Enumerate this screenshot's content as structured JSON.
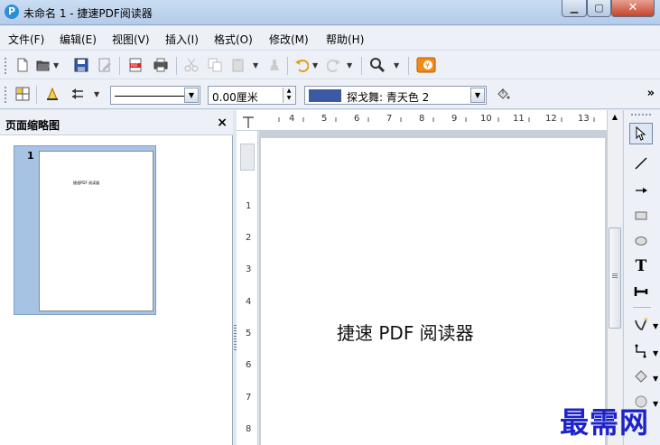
{
  "window": {
    "title": "未命名 1 - 捷速PDF阅读器",
    "app_icon_glyph": "P",
    "min_glyph": "▁",
    "max_glyph": "▢",
    "close_glyph": "✕"
  },
  "menu": [
    {
      "label": "文件(F)"
    },
    {
      "label": "编辑(E)"
    },
    {
      "label": "视图(V)"
    },
    {
      "label": "插入(I)"
    },
    {
      "label": "格式(O)"
    },
    {
      "label": "修改(M)"
    },
    {
      "label": "帮助(H)"
    }
  ],
  "toolbar1": {
    "icons": [
      "new-icon",
      "open-icon",
      "save-icon",
      "edit-icon",
      "export-pdf-icon",
      "print-icon",
      "cut-icon",
      "copy-icon",
      "paste-icon",
      "clone-icon",
      "undo-icon",
      "redo-icon",
      "zoom-icon",
      "extension-icon"
    ]
  },
  "toolbar2": {
    "line_width_value": "0.00厘米",
    "area_color_label": "探戈舞: 青天色 2",
    "area_color": "#3b5aa3",
    "more_glyph": "»"
  },
  "left_panel": {
    "title": "页面缩略图",
    "close_glyph": "×",
    "page_number": "1",
    "thumb_text": "捷速PDF 阅读器"
  },
  "ruler": {
    "h_numbers": [
      "4",
      "5",
      "6",
      "7",
      "8",
      "9",
      "10",
      "11",
      "12",
      "13"
    ],
    "v_numbers": [
      "1",
      "2",
      "3",
      "4",
      "5",
      "6",
      "7",
      "8"
    ]
  },
  "document": {
    "text": "捷速 PDF 阅读器"
  },
  "drawbar": {
    "select_glyph": "⇱",
    "text_glyph": "T"
  },
  "watermark": {
    "text": "最需网"
  }
}
